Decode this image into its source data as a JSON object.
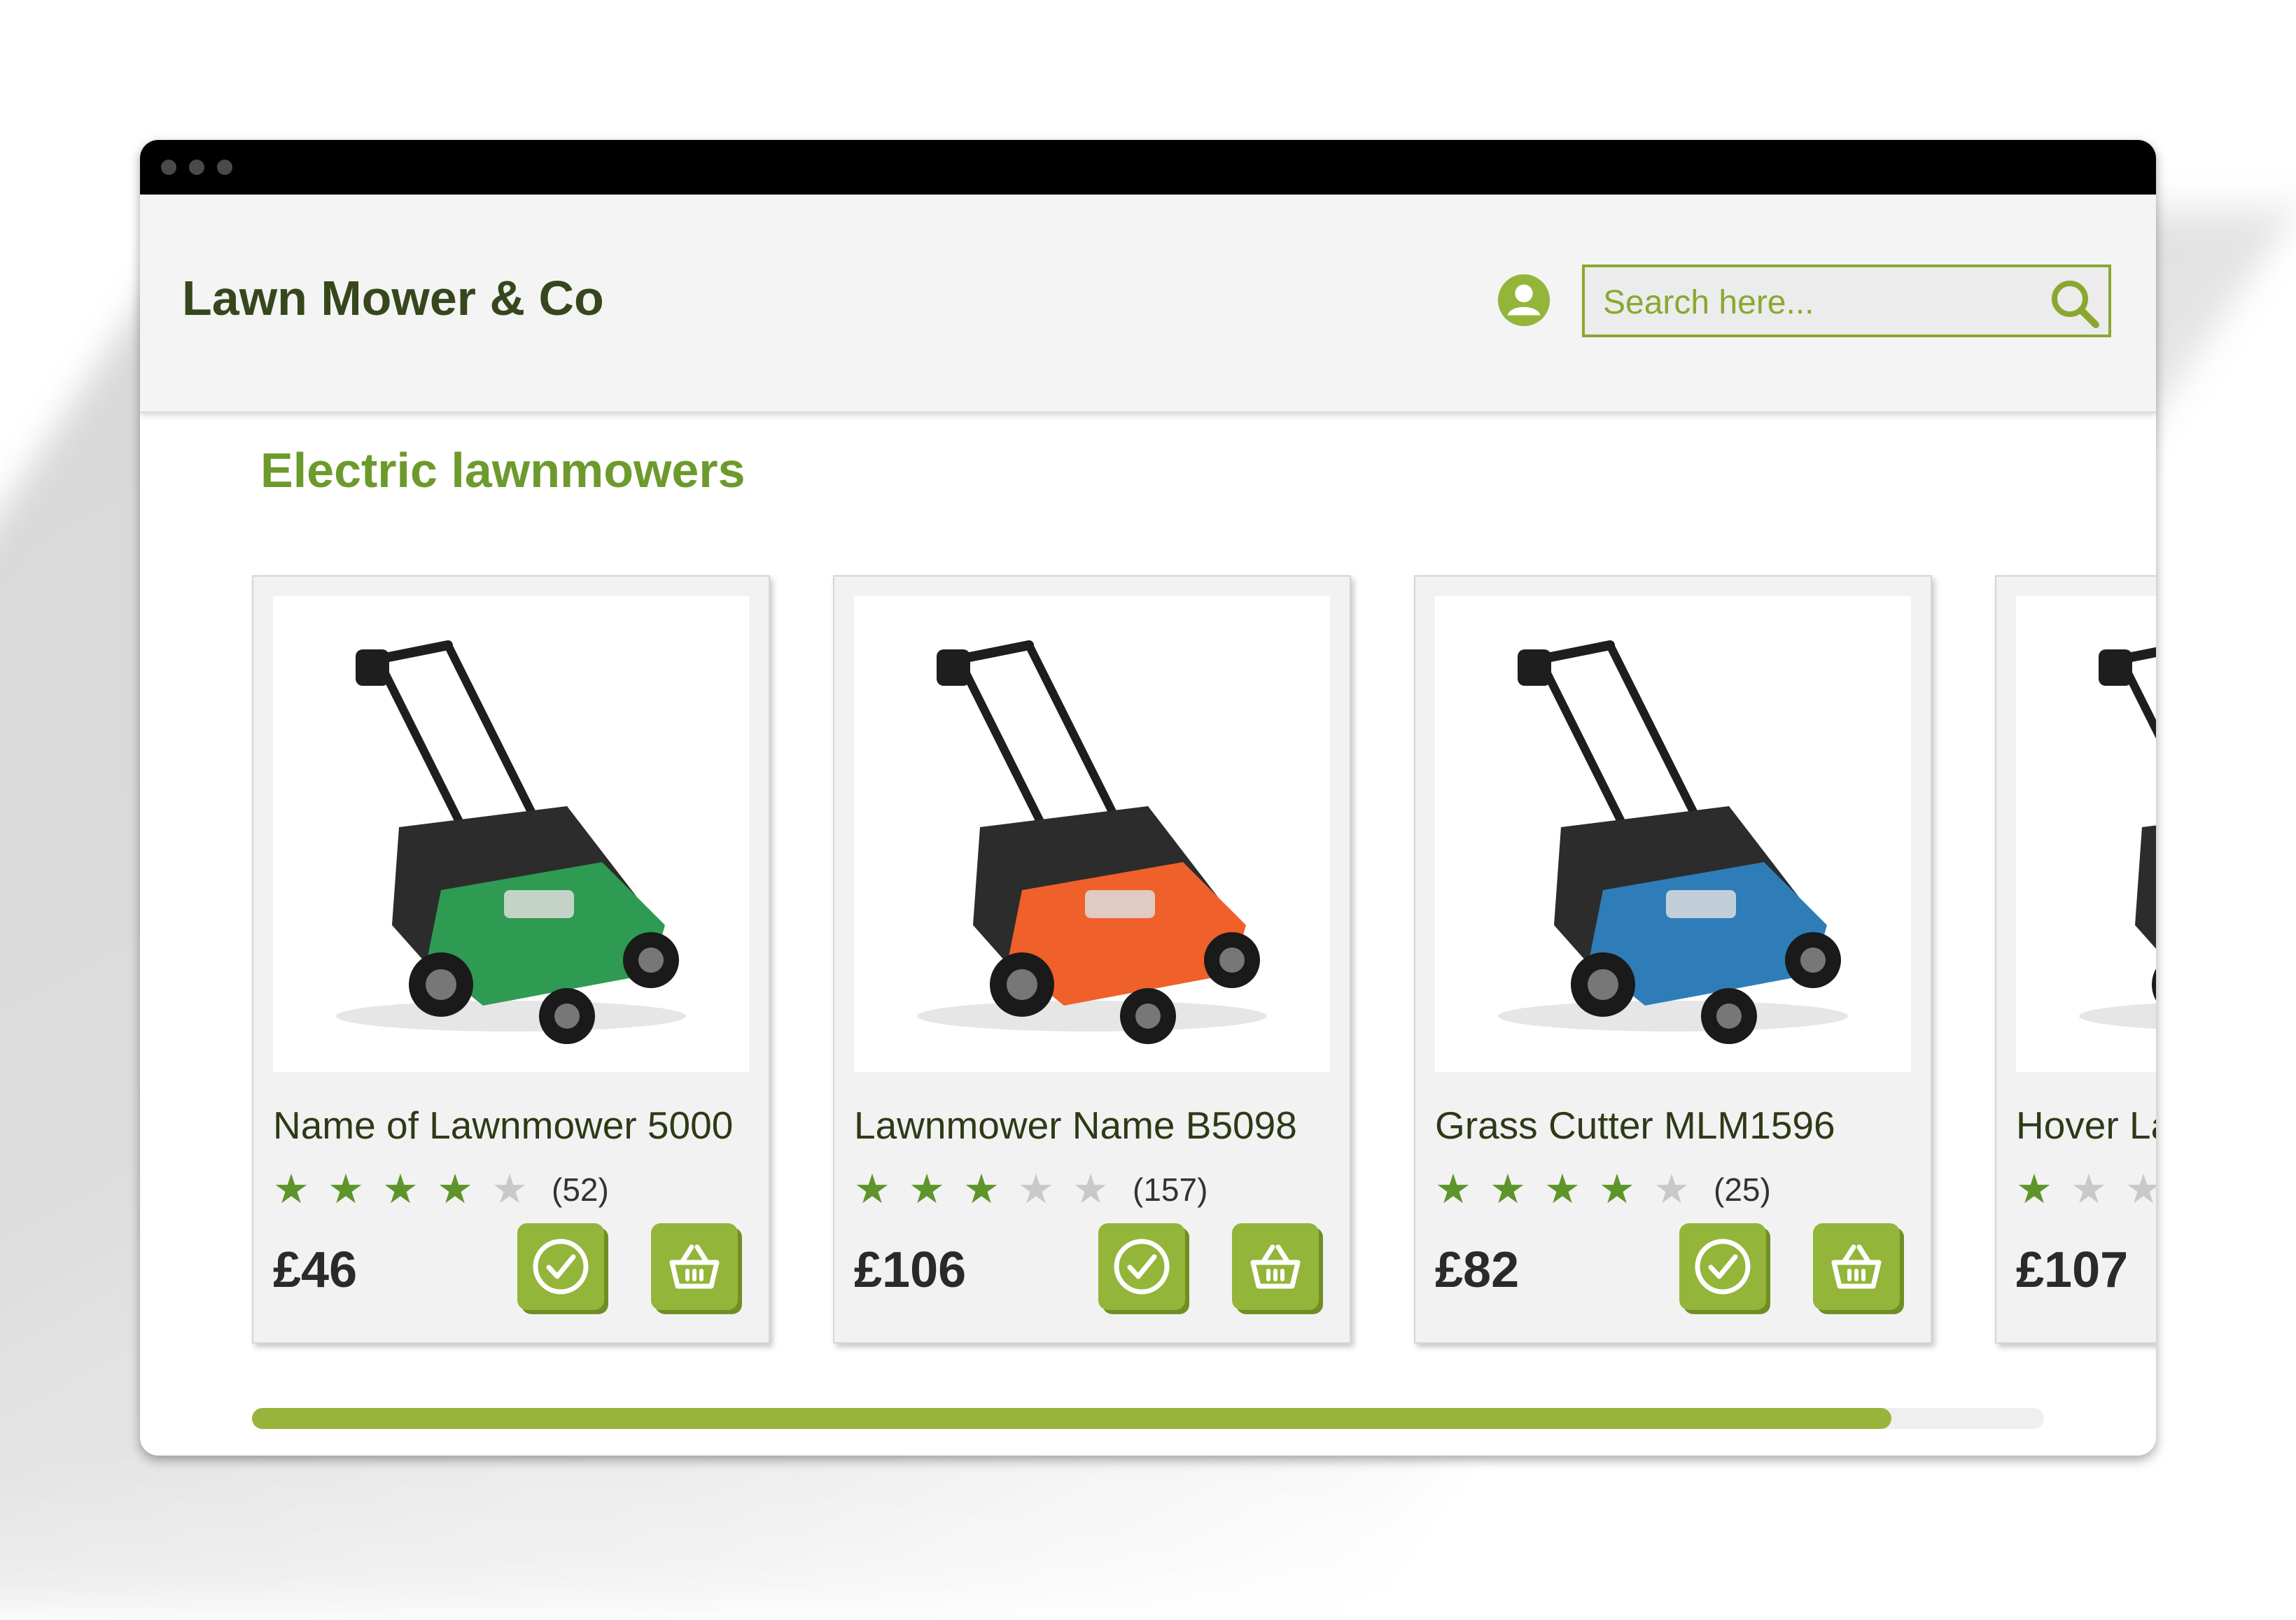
{
  "header": {
    "brand": "Lawn Mower & Co",
    "search_placeholder": "Search here..."
  },
  "section": {
    "title": "Electric lawnmowers"
  },
  "products": [
    {
      "name": "Name of Lawnmower 5000",
      "rating": 4,
      "reviews": "(52)",
      "price": "£46",
      "color": "#2e9a52"
    },
    {
      "name": "Lawnmower Name B5098",
      "rating": 3,
      "reviews": "(157)",
      "price": "£106",
      "color": "#f0602a"
    },
    {
      "name": "Grass Cutter MLM1596",
      "rating": 4,
      "reviews": "(25)",
      "price": "£82",
      "color": "#2e7db8"
    },
    {
      "name": "Hover La",
      "rating": 1,
      "reviews": "",
      "price": "£107",
      "color": "#ef6a24"
    }
  ],
  "carousel": {
    "scroll_progress": 0.915
  },
  "colors": {
    "brand_green": "#93b53a",
    "title_green": "#6d9a2c",
    "dark_text": "#37471d"
  },
  "icons": [
    "account-icon",
    "search-icon",
    "check-icon",
    "basket-icon",
    "star-icon",
    "lawnmower-image"
  ]
}
